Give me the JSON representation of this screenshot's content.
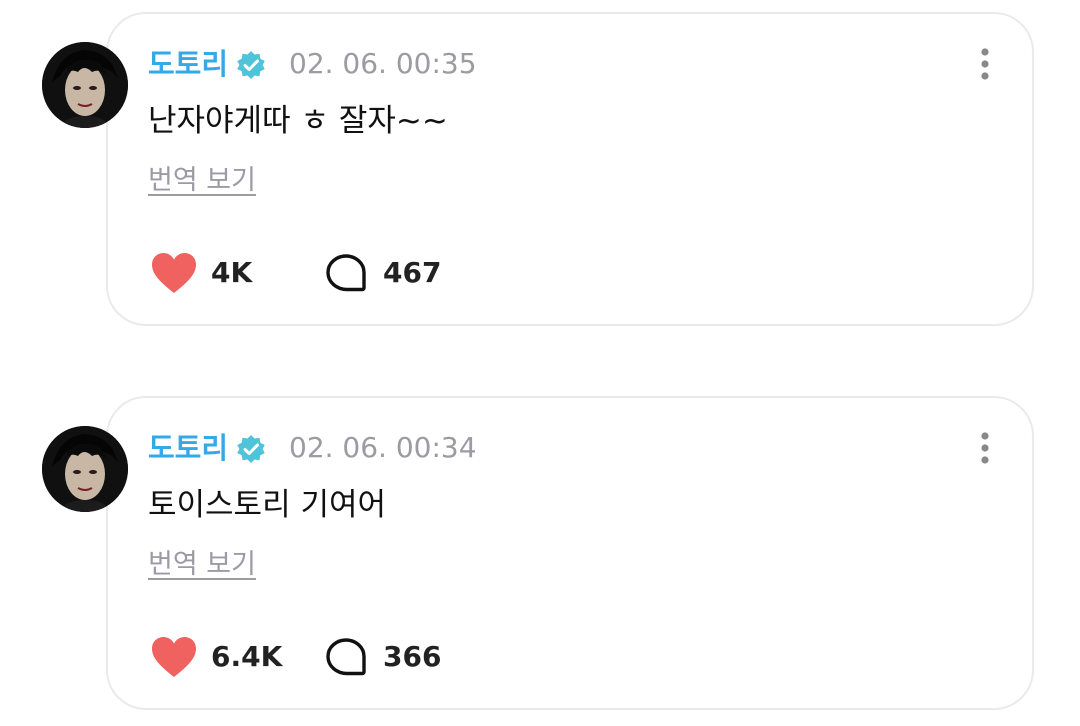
{
  "posts": [
    {
      "author": "도토리",
      "timestamp": "02. 06. 00:35",
      "content": "난자야게따 ㅎ 잘자~~",
      "translate_label": "번역 보기",
      "likes": "4K",
      "comments": "467"
    },
    {
      "author": "도토리",
      "timestamp": "02. 06. 00:34",
      "content": "토이스토리 기여어",
      "translate_label": "번역 보기",
      "likes": "6.4K",
      "comments": "366"
    }
  ],
  "colors": {
    "author": "#35a8e8",
    "verified_badge": "#4fc3d9",
    "like_heart": "#f0625f",
    "muted_text": "#9b9ba3",
    "card_border": "#e9e9ee"
  },
  "icons": {
    "verified": "verified-badge-icon",
    "more": "more-vertical-icon",
    "like": "heart-icon",
    "comment": "comment-bubble-icon"
  }
}
